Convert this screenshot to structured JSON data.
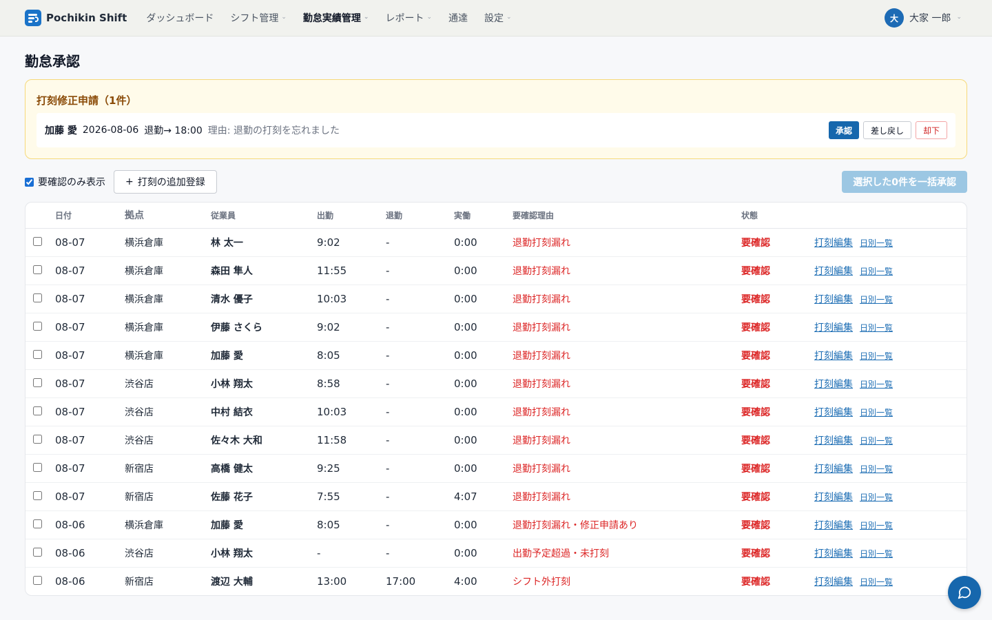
{
  "brand": {
    "name": "Pochikin Shift"
  },
  "nav": {
    "items": [
      {
        "label": "ダッシュボード",
        "dropdown": false,
        "active": false
      },
      {
        "label": "シフト管理",
        "dropdown": true,
        "active": false
      },
      {
        "label": "勤怠実績管理",
        "dropdown": true,
        "active": true
      },
      {
        "label": "レポート",
        "dropdown": true,
        "active": false
      },
      {
        "label": "通達",
        "dropdown": false,
        "active": false
      },
      {
        "label": "設定",
        "dropdown": true,
        "active": false
      }
    ]
  },
  "user": {
    "avatar_initial": "大",
    "name": "大家 一郎"
  },
  "page": {
    "title": "勤怠承認"
  },
  "requests": {
    "title": "打刻修正申請（1件）",
    "items": [
      {
        "name": "加藤 愛",
        "date": "2026-08-06",
        "change": "退勤→ 18:00",
        "reason": "理由: 退勤の打刻を忘れました"
      }
    ],
    "approve_label": "承認",
    "return_label": "差し戻し",
    "reject_label": "却下"
  },
  "toolbar": {
    "filter_label": "要確認のみ表示",
    "filter_checked": true,
    "add_label": "打刻の追加登録",
    "bulk_label": "選択した0件を一括承認"
  },
  "table": {
    "headers": {
      "date": "日付",
      "site": "拠点",
      "employee": "従業員",
      "clock_in": "出勤",
      "clock_out": "退勤",
      "worked": "実働",
      "reason": "要確認理由",
      "status": "状態"
    },
    "edit_label": "打刻編集",
    "daily_label": "日別一覧",
    "rows": [
      {
        "date": "08-07",
        "site": "横浜倉庫",
        "employee": "林 太一",
        "clock_in": "9:02",
        "clock_out": "-",
        "worked": "0:00",
        "reason": "退勤打刻漏れ",
        "status": "要確認"
      },
      {
        "date": "08-07",
        "site": "横浜倉庫",
        "employee": "森田 隼人",
        "clock_in": "11:55",
        "clock_out": "-",
        "worked": "0:00",
        "reason": "退勤打刻漏れ",
        "status": "要確認"
      },
      {
        "date": "08-07",
        "site": "横浜倉庫",
        "employee": "清水 優子",
        "clock_in": "10:03",
        "clock_out": "-",
        "worked": "0:00",
        "reason": "退勤打刻漏れ",
        "status": "要確認"
      },
      {
        "date": "08-07",
        "site": "横浜倉庫",
        "employee": "伊藤 さくら",
        "clock_in": "9:02",
        "clock_out": "-",
        "worked": "0:00",
        "reason": "退勤打刻漏れ",
        "status": "要確認"
      },
      {
        "date": "08-07",
        "site": "横浜倉庫",
        "employee": "加藤 愛",
        "clock_in": "8:05",
        "clock_out": "-",
        "worked": "0:00",
        "reason": "退勤打刻漏れ",
        "status": "要確認"
      },
      {
        "date": "08-07",
        "site": "渋谷店",
        "employee": "小林 翔太",
        "clock_in": "8:58",
        "clock_out": "-",
        "worked": "0:00",
        "reason": "退勤打刻漏れ",
        "status": "要確認"
      },
      {
        "date": "08-07",
        "site": "渋谷店",
        "employee": "中村 結衣",
        "clock_in": "10:03",
        "clock_out": "-",
        "worked": "0:00",
        "reason": "退勤打刻漏れ",
        "status": "要確認"
      },
      {
        "date": "08-07",
        "site": "渋谷店",
        "employee": "佐々木 大和",
        "clock_in": "11:58",
        "clock_out": "-",
        "worked": "0:00",
        "reason": "退勤打刻漏れ",
        "status": "要確認"
      },
      {
        "date": "08-07",
        "site": "新宿店",
        "employee": "高橋 健太",
        "clock_in": "9:25",
        "clock_out": "-",
        "worked": "0:00",
        "reason": "退勤打刻漏れ",
        "status": "要確認"
      },
      {
        "date": "08-07",
        "site": "新宿店",
        "employee": "佐藤 花子",
        "clock_in": "7:55",
        "clock_out": "-",
        "worked": "4:07",
        "reason": "退勤打刻漏れ",
        "status": "要確認"
      },
      {
        "date": "08-06",
        "site": "横浜倉庫",
        "employee": "加藤 愛",
        "clock_in": "8:05",
        "clock_out": "-",
        "worked": "0:00",
        "reason": "退勤打刻漏れ・修正申請あり",
        "status": "要確認"
      },
      {
        "date": "08-06",
        "site": "渋谷店",
        "employee": "小林 翔太",
        "clock_in": "-",
        "clock_out": "-",
        "worked": "0:00",
        "reason": "出勤予定超過・未打刻",
        "status": "要確認"
      },
      {
        "date": "08-06",
        "site": "新宿店",
        "employee": "渡辺 大輔",
        "clock_in": "13:00",
        "clock_out": "17:00",
        "worked": "4:00",
        "reason": "シフト外打刻",
        "status": "要確認"
      }
    ]
  },
  "icons": {
    "chat": "chat-bubble-icon",
    "plus": "plus-icon",
    "chevron": "chevron-down-icon"
  },
  "colors": {
    "primary": "#1667ad",
    "danger": "#dc2626",
    "warning_bg": "#fffbea",
    "bulk_disabled": "#9cc7e3"
  }
}
